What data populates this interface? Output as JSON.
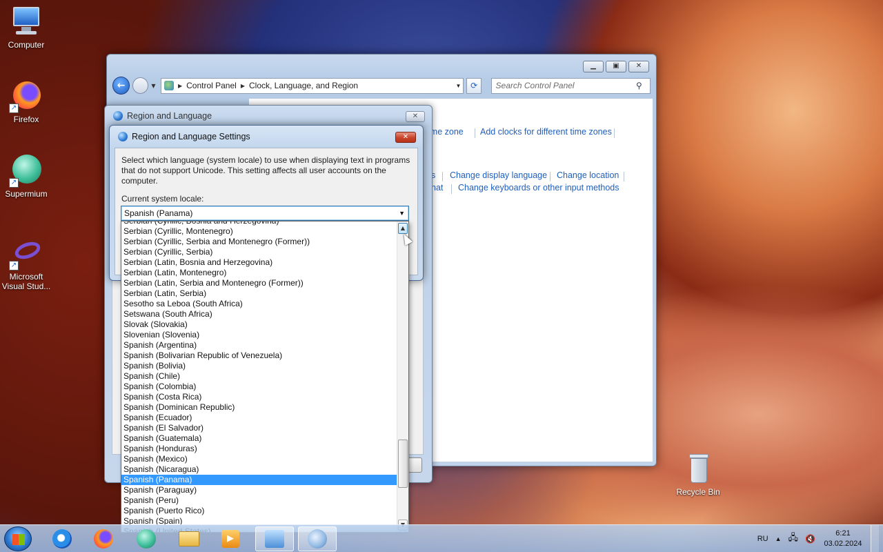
{
  "desktop": {
    "icons": [
      {
        "label": "Computer"
      },
      {
        "label": "Firefox"
      },
      {
        "label": "Supermium"
      },
      {
        "label": "Microsoft Visual Stud..."
      },
      {
        "label": "Recycle Bin"
      }
    ]
  },
  "control_panel": {
    "breadcrumb": [
      "Control Panel",
      "Clock, Language, and Region"
    ],
    "search_placeholder": "Search Control Panel",
    "links": {
      "time_zone_partial": "ime zone",
      "add_clocks": "Add clocks for different time zones",
      "s_partial": "s",
      "change_display_language": "Change display language",
      "change_location": "Change location",
      "hat_partial": "hat",
      "change_keyboards": "Change keyboards or other input methods"
    }
  },
  "region_dialog": {
    "title": "Region and Language"
  },
  "settings_dialog": {
    "title": "Region and Language Settings",
    "description": "Select which language (system locale) to use when displaying text in programs that do not support Unicode. This setting affects all user accounts on the computer.",
    "current_locale_label": "Current system locale:",
    "selected_locale": "Spanish (Panama)",
    "options": [
      "Serbian (Cyrillic, Bosnia and Herzegovina)",
      "Serbian (Cyrillic, Montenegro)",
      "Serbian (Cyrillic, Serbia and Montenegro (Former))",
      "Serbian (Cyrillic, Serbia)",
      "Serbian (Latin, Bosnia and Herzegovina)",
      "Serbian (Latin, Montenegro)",
      "Serbian (Latin, Serbia and Montenegro (Former))",
      "Serbian (Latin, Serbia)",
      "Sesotho sa Leboa (South Africa)",
      "Setswana (South Africa)",
      "Slovak (Slovakia)",
      "Slovenian (Slovenia)",
      "Spanish (Argentina)",
      "Spanish (Bolivarian Republic of Venezuela)",
      "Spanish (Bolivia)",
      "Spanish (Chile)",
      "Spanish (Colombia)",
      "Spanish (Costa Rica)",
      "Spanish (Dominican Republic)",
      "Spanish (Ecuador)",
      "Spanish (El Salvador)",
      "Spanish (Guatemala)",
      "Spanish (Honduras)",
      "Spanish (Mexico)",
      "Spanish (Nicaragua)",
      "Spanish (Panama)",
      "Spanish (Paraguay)",
      "Spanish (Peru)",
      "Spanish (Puerto Rico)",
      "Spanish (Spain)",
      "Spanish (United States)"
    ],
    "selected_index": 25
  },
  "taskbar": {
    "language": "RU",
    "time": "6:21",
    "date": "03.02.2024"
  },
  "colors": {
    "selection": "#3399ff",
    "link": "#1e5fbd",
    "close_red": "#c7442a"
  }
}
